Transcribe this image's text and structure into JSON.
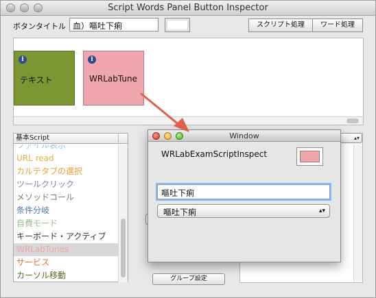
{
  "main_window": {
    "title": "Script Words Panel Button Inspector",
    "button_title_label": "ボタンタイトル",
    "button_title_value": "血）嘔吐下痢",
    "segments": [
      "スクリプト処理",
      "ワード処理"
    ]
  },
  "canvas": {
    "buttons": [
      {
        "label": "テキスト",
        "info": "i",
        "color": "#7b9632"
      },
      {
        "label": "WRLabTune",
        "info": "i",
        "color": "#f0a6ad"
      }
    ]
  },
  "script_list": {
    "header": "基本Script",
    "items": [
      {
        "label": "ファイル表示",
        "color": "#8fc5e8"
      },
      {
        "label": "URL read",
        "color": "#e8b040"
      },
      {
        "label": "カルテタブの選択",
        "color": "#e8a030"
      },
      {
        "label": "ツールクリック",
        "color": "#8a7ab8"
      },
      {
        "label": "メソッドコール",
        "color": "#7a7a7a"
      },
      {
        "label": "条件分岐",
        "color": "#4a7ab0"
      },
      {
        "label": "自費モード",
        "color": "#9abf8a"
      },
      {
        "label": "キーボード・アクティブ",
        "color": "#333333"
      },
      {
        "label": "WRLabTunes",
        "color": "#f0a6ad"
      },
      {
        "label": "サービス",
        "color": "#e8702a"
      },
      {
        "label": "カーソル移動",
        "color": "#5a6a20"
      }
    ]
  },
  "group_button": "グループ設定",
  "float_window": {
    "title": "Window",
    "heading": "WRLabExamScriptInspect",
    "text_value": "嘔吐下痢",
    "popup_value": "嘔吐下痢",
    "well_color": "#f0a6ad"
  },
  "icons": {
    "info": "info-icon",
    "popup_arrows": "updown-arrows-icon",
    "arrow_color": "#e0604a"
  }
}
